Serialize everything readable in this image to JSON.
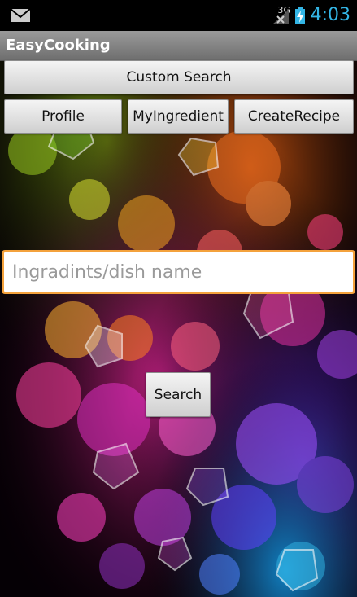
{
  "status_bar": {
    "network": "3G",
    "time": "4:03",
    "icons": [
      "mail-icon",
      "signal-icon",
      "battery-charging-icon"
    ],
    "time_color": "#33b5e5"
  },
  "app": {
    "title": "EasyCooking"
  },
  "buttons": {
    "custom_search": "Custom Search",
    "profile": "Profile",
    "my_ingredient": "MyIngredient",
    "create_recipe": "CreateRecipe",
    "search": "Search"
  },
  "search": {
    "placeholder": "Ingradints/dish name",
    "value": "",
    "focus_color": "#f4a23c"
  }
}
